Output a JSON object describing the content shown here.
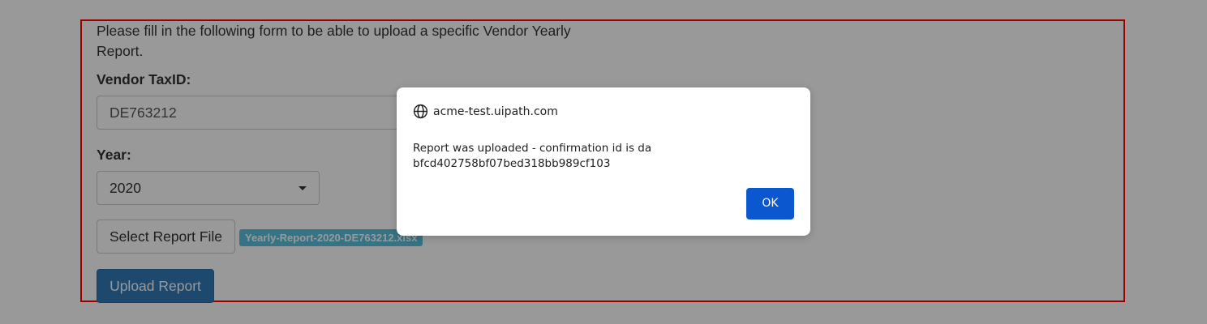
{
  "form": {
    "intro_text": "Please fill in the following form to be able to upload a specific Vendor Yearly Report.",
    "tax_id_label": "Vendor TaxID:",
    "tax_id_value": "DE763212",
    "year_label": "Year:",
    "year_value": "2020",
    "select_file_label": "Select Report File",
    "selected_file_name": "Yearly-Report-2020-DE763212.xlsx",
    "upload_label": "Upload Report"
  },
  "dialog": {
    "origin": "acme-test.uipath.com",
    "message": "Report was uploaded - confirmation id is dabfcd402758bf07bed318bb989cf103",
    "ok_label": "OK",
    "icon": "globe-icon"
  },
  "colors": {
    "highlight_border": "#ff0000",
    "primary_button": "#337ab7",
    "file_badge": "#5bc0de",
    "dialog_ok": "#0b57d0"
  }
}
